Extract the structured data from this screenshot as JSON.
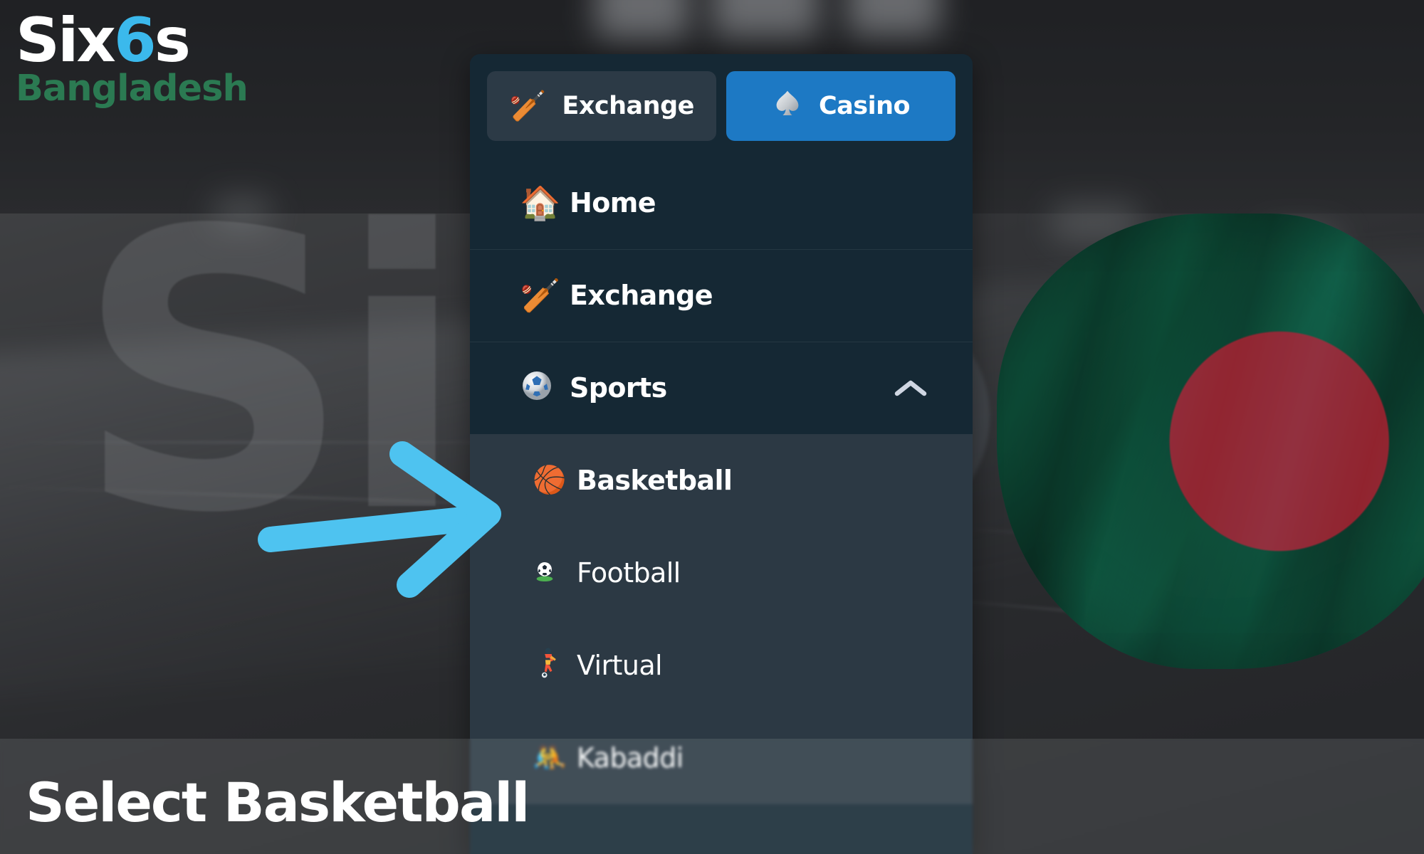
{
  "brand": {
    "logo_line1_prefix": "Six",
    "logo_line1_accent": "6",
    "logo_line1_suffix": "s",
    "logo_line2": "Bangladesh",
    "accent_blue": "#3bb9ec",
    "green": "#2b7a52"
  },
  "watermark": {
    "text": "Si"
  },
  "menu": {
    "modes": [
      {
        "label": "Exchange",
        "icon": "cricket-bat-icon",
        "glyph": "🏏",
        "active": false,
        "bg": "#2c3a46"
      },
      {
        "label": "Casino",
        "icon": "spade-icon",
        "glyph": "♠",
        "active": true,
        "bg": "#1d79c4"
      }
    ],
    "items": [
      {
        "label": "Home",
        "icon": "house-icon",
        "glyph": "🏠",
        "expandable": false
      },
      {
        "label": "Exchange",
        "icon": "cricket-bat-icon",
        "glyph": "🏏",
        "expandable": false
      },
      {
        "label": "Sports",
        "icon": "soccer-ball-icon",
        "glyph": "⚽",
        "expandable": true,
        "expanded": true,
        "chevron": "chevron-up-icon"
      }
    ],
    "submenu": [
      {
        "label": "Basketball",
        "icon": "basketball-icon",
        "glyph": "🏀",
        "selected": true
      },
      {
        "label": "Football",
        "icon": "football-pitch-icon",
        "glyph": "⚽",
        "selected": false
      },
      {
        "label": "Virtual",
        "icon": "soccer-player-icon",
        "glyph": "⚽",
        "selected": false
      },
      {
        "label": "Kabaddi",
        "icon": "kabaddi-wrestlers-icon",
        "glyph": "🤼",
        "selected": false
      }
    ]
  },
  "annotation": {
    "arrow": "right-arrow-annotation",
    "arrow_color": "#4ec3f0",
    "caption": "Select Basketball"
  },
  "flag": {
    "name": "bangladesh-flag",
    "green": "#0d8159",
    "red": "#f6445a"
  }
}
